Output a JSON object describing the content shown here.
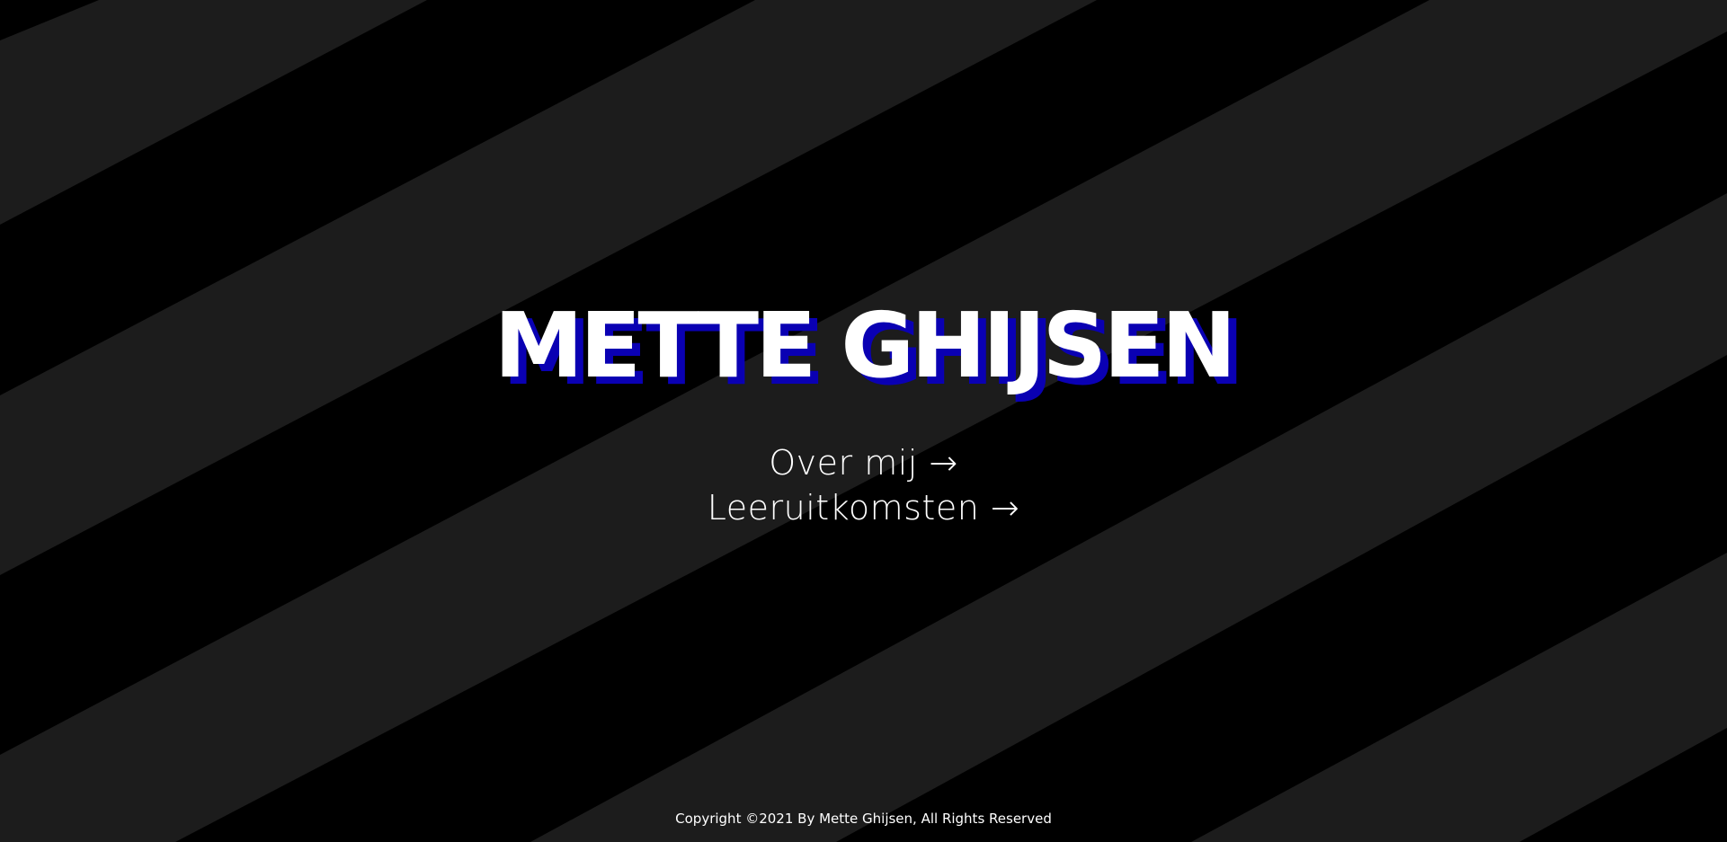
{
  "header": {
    "title": "METTE GHIJSEN"
  },
  "nav": {
    "items": [
      {
        "label": "Over mij →"
      },
      {
        "label": "Leeruitkomsten →"
      }
    ]
  },
  "footer": {
    "copyright": "Copyright ©2021 By Mette Ghijsen, All Rights Reserved"
  },
  "colors": {
    "background": "#000000",
    "stripe": "#1c1c1c",
    "text": "#ffffff",
    "title_shadow": "#0a00b3"
  }
}
